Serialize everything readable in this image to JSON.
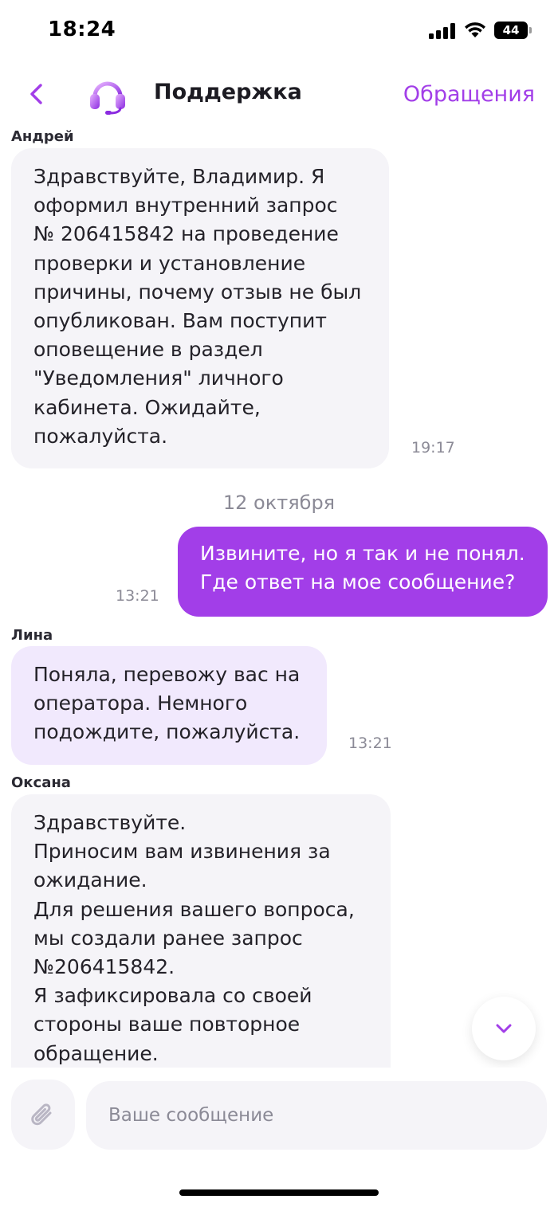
{
  "status_bar": {
    "time": "18:24",
    "battery": "44"
  },
  "header": {
    "title": "Поддержка",
    "appeals_link": "Обращения"
  },
  "messages": [
    {
      "sender": "Андрей",
      "direction": "in",
      "text": "Здравствуйте, Владимир. Я\nоформил внутренний запрос\n№ 206415842 на проведение\nпроверки и установление\nпричины, почему отзыв не был\nопубликован. Вам поступит\nоповещение в раздел\n\"Уведомления\" личного\nкабинета. Ожидайте,\nпожалуйста.",
      "time": "19:17"
    },
    {
      "date_separator": "12 октября"
    },
    {
      "sender": "",
      "direction": "out",
      "text": "Извините, но я так и не понял.\nГде ответ на мое сообщение?",
      "time": "13:21"
    },
    {
      "sender": "Лина",
      "direction": "in",
      "style": "bot",
      "text": "Поняла, перевожу вас на\nоператора. Немного\nподождите, пожалуйста.",
      "time": "13:21"
    },
    {
      "sender": "Оксана",
      "direction": "in",
      "text": "Здравствуйте.\nПриносим вам извинения за\nожидание.\nДля решения вашего вопроса,\nмы создали ранее запрос\n№206415842.\nЯ зафиксировала со своей\nстороны ваше повторное\nобращение."
    }
  ],
  "composer": {
    "placeholder": "Ваше сообщение"
  },
  "icons": {
    "back": "chevron-left-icon",
    "support": "headset-icon",
    "scroll_down": "chevron-down-icon",
    "attach": "paperclip-icon"
  },
  "colors": {
    "accent": "#a23ee8",
    "incoming_bubble": "#f5f4f8",
    "bot_bubble": "#f1e9fd",
    "muted_text": "#8b8a96"
  }
}
